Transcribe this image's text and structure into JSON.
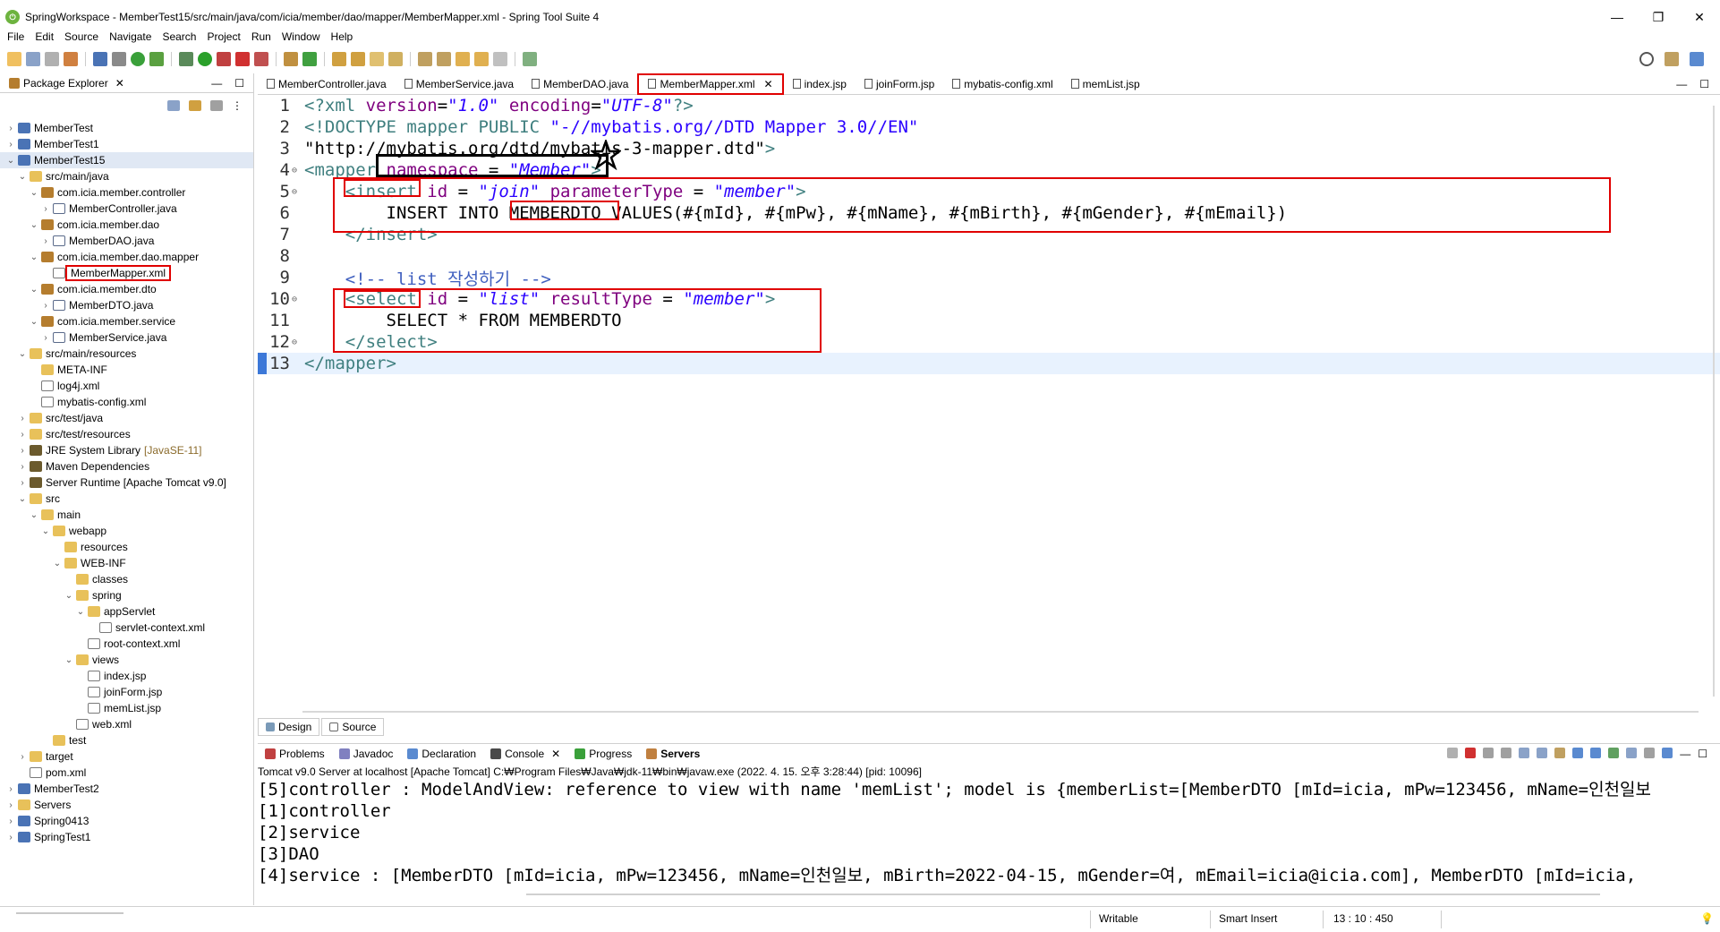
{
  "window": {
    "title": "SpringWorkspace - MemberTest15/src/main/java/com/icia/member/dao/mapper/MemberMapper.xml - Spring Tool Suite 4",
    "minimize": "—",
    "maximize": "❐",
    "close": "✕"
  },
  "menu": [
    "File",
    "Edit",
    "Source",
    "Navigate",
    "Search",
    "Project",
    "Run",
    "Window",
    "Help"
  ],
  "explorer": {
    "title": "Package Explorer",
    "items": [
      {
        "label": "MemberTest",
        "icon": "project-icon"
      },
      {
        "label": "MemberTest1",
        "icon": "project-icon"
      },
      {
        "label": "MemberTest15",
        "icon": "project-icon"
      },
      {
        "label": "src/main/java",
        "icon": "source-folder-icon"
      },
      {
        "label": "com.icia.member.controller",
        "icon": "package-icon"
      },
      {
        "label": "MemberController.java",
        "icon": "java-file-icon"
      },
      {
        "label": "com.icia.member.dao",
        "icon": "package-icon"
      },
      {
        "label": "MemberDAO.java",
        "icon": "java-file-icon"
      },
      {
        "label": "com.icia.member.dao.mapper",
        "icon": "package-icon"
      },
      {
        "label": "MemberMapper.xml",
        "icon": "xml-file-icon"
      },
      {
        "label": "com.icia.member.dto",
        "icon": "package-icon"
      },
      {
        "label": "MemberDTO.java",
        "icon": "java-file-icon"
      },
      {
        "label": "com.icia.member.service",
        "icon": "package-icon"
      },
      {
        "label": "MemberService.java",
        "icon": "java-file-icon"
      },
      {
        "label": "src/main/resources",
        "icon": "source-folder-icon"
      },
      {
        "label": "META-INF",
        "icon": "folder-icon"
      },
      {
        "label": "log4j.xml",
        "icon": "xml-file-icon"
      },
      {
        "label": "mybatis-config.xml",
        "icon": "xml-file-icon"
      },
      {
        "label": "src/test/java",
        "icon": "source-folder-icon"
      },
      {
        "label": "src/test/resources",
        "icon": "source-folder-icon"
      },
      {
        "label": "JRE System Library",
        "suffix": "[JavaSE-11]",
        "icon": "library-icon"
      },
      {
        "label": "Maven Dependencies",
        "icon": "library-icon"
      },
      {
        "label": "Server Runtime [Apache Tomcat v9.0]",
        "icon": "library-icon"
      },
      {
        "label": "src",
        "icon": "folder-icon"
      },
      {
        "label": "main",
        "icon": "folder-icon"
      },
      {
        "label": "webapp",
        "icon": "folder-icon"
      },
      {
        "label": "resources",
        "icon": "folder-icon"
      },
      {
        "label": "WEB-INF",
        "icon": "folder-icon"
      },
      {
        "label": "classes",
        "icon": "folder-icon"
      },
      {
        "label": "spring",
        "icon": "folder-icon"
      },
      {
        "label": "appServlet",
        "icon": "folder-icon"
      },
      {
        "label": "servlet-context.xml",
        "icon": "xml-file-icon"
      },
      {
        "label": "root-context.xml",
        "icon": "xml-file-icon"
      },
      {
        "label": "views",
        "icon": "folder-icon"
      },
      {
        "label": "index.jsp",
        "icon": "jsp-file-icon"
      },
      {
        "label": "joinForm.jsp",
        "icon": "jsp-file-icon"
      },
      {
        "label": "memList.jsp",
        "icon": "jsp-file-icon"
      },
      {
        "label": "web.xml",
        "icon": "xml-file-icon"
      },
      {
        "label": "test",
        "icon": "folder-icon"
      },
      {
        "label": "target",
        "icon": "folder-icon"
      },
      {
        "label": "pom.xml",
        "icon": "xml-file-icon"
      },
      {
        "label": "MemberTest2",
        "icon": "project-icon"
      },
      {
        "label": "Servers",
        "icon": "folder-icon"
      },
      {
        "label": "Spring0413",
        "icon": "project-icon"
      },
      {
        "label": "SpringTest1",
        "icon": "project-icon"
      }
    ]
  },
  "editor_tabs": [
    {
      "label": "MemberController.java"
    },
    {
      "label": "MemberService.java"
    },
    {
      "label": "MemberDAO.java"
    },
    {
      "label": "MemberMapper.xml",
      "active": true
    },
    {
      "label": "index.jsp"
    },
    {
      "label": "joinForm.jsp"
    },
    {
      "label": "mybatis-config.xml"
    },
    {
      "label": "memList.jsp"
    }
  ],
  "code": {
    "line_numbers": [
      "1",
      "2",
      "3",
      "4",
      "5",
      "6",
      "7",
      "8",
      "9",
      "10",
      "11",
      "12",
      "13"
    ],
    "l1": {
      "open": "<?xml ",
      "a1": "version",
      "eq1": "=",
      "v1": "\"1.0\"",
      "a2": " encoding",
      "eq2": "=",
      "v2": "\"UTF-8\"",
      "close": "?>"
    },
    "l2": {
      "text": "<!DOCTYPE mapper PUBLIC ",
      "v": "\"-//mybatis.org//DTD Mapper 3.0//EN\""
    },
    "l3": {
      "v": "\"http://mybatis.org/dtd/mybatis-3-mapper.dtd\"",
      "close": ">"
    },
    "l4": {
      "open": "<mapper",
      "a": " namespace",
      "eq": " = ",
      "v": "\"Member\"",
      "close": ">"
    },
    "l5": {
      "open": "<insert",
      "a1": " id",
      "eq1": " = ",
      "v1": "\"join\"",
      "a2": " parameterType",
      "eq2": " = ",
      "v2": "\"member\"",
      "close": ">"
    },
    "l6": {
      "text": "INSERT INTO MEMBERDTO VALUES(#{mId}, #{mPw}, #{mName}, #{mBirth}, #{mGender}, #{mEmail})"
    },
    "l7": {
      "close": "</insert>"
    },
    "l9": {
      "comment": "<!-- list 작성하기 -->"
    },
    "l10": {
      "open": "<select",
      "a1": " id",
      "eq1": " = ",
      "v1": "\"list\"",
      "a2": " resultType",
      "eq2": " = ",
      "v2": "\"member\"",
      "close": ">"
    },
    "l11": {
      "text": "SELECT * FROM MEMBERDTO"
    },
    "l12": {
      "close": "</select>"
    },
    "l13": {
      "close": "</mapper>"
    }
  },
  "bottom_tabs": {
    "design": "Design",
    "source": "Source"
  },
  "console": {
    "tabs": [
      {
        "label": "Problems"
      },
      {
        "label": "Javadoc"
      },
      {
        "label": "Declaration"
      },
      {
        "label": "Console",
        "active": true
      },
      {
        "label": "Progress"
      },
      {
        "label": "Servers"
      }
    ],
    "info": "Tomcat v9.0 Server at localhost [Apache Tomcat] C:₩Program Files₩Java₩jdk-11₩bin₩javaw.exe  (2022. 4. 15. 오후 3:28:44) [pid: 10096]",
    "lines": [
      "[5]controller : ModelAndView: reference to view with name 'memList'; model is {memberList=[MemberDTO [mId=icia, mPw=123456, mName=인천일보",
      "[1]controller",
      "[2]service",
      "[3]DAO",
      "[4]service : [MemberDTO [mId=icia, mPw=123456, mName=인천일보, mBirth=2022-04-15, mGender=여, mEmail=icia@icia.com], MemberDTO [mId=icia,"
    ]
  },
  "status": {
    "writable": "Writable",
    "insert": "Smart Insert",
    "position": "13 : 10 : 450"
  },
  "colors": {
    "tag": "#3f7f7f",
    "attr": "#7f007f",
    "string": "#2a00ff",
    "comment": "#3f5fbf",
    "highlight": "#e00000"
  }
}
